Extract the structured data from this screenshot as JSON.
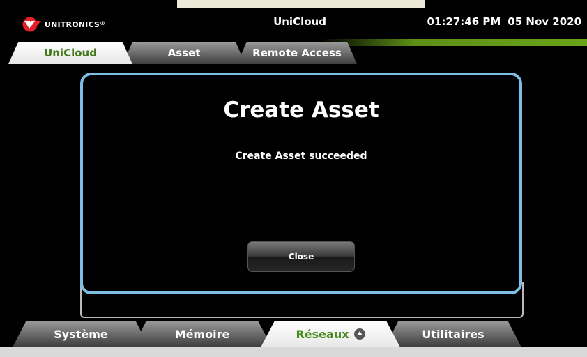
{
  "header": {
    "logo_text": "UNITRONICS",
    "logo_registered": "®",
    "title": "UniCloud",
    "time": "01:27:46 PM",
    "date": "05 Nov 2020"
  },
  "top_tabs": [
    {
      "label": "UniCloud",
      "active": true
    },
    {
      "label": "Asset",
      "active": false
    },
    {
      "label": "Remote Access",
      "active": false
    }
  ],
  "dialog": {
    "title": "Create Asset",
    "message": "Create Asset succeeded",
    "close_label": "Close"
  },
  "bottom_tabs": [
    {
      "label": "Système",
      "active": false
    },
    {
      "label": "Mémoire",
      "active": false
    },
    {
      "label": "Réseaux",
      "active": true,
      "icon": "chevron-up-icon"
    },
    {
      "label": "Utilitaires",
      "active": false
    }
  ],
  "colors": {
    "accent_green": "#4a8a1c",
    "dialog_border": "#7dbde6",
    "logo_red": "#e3212b"
  }
}
